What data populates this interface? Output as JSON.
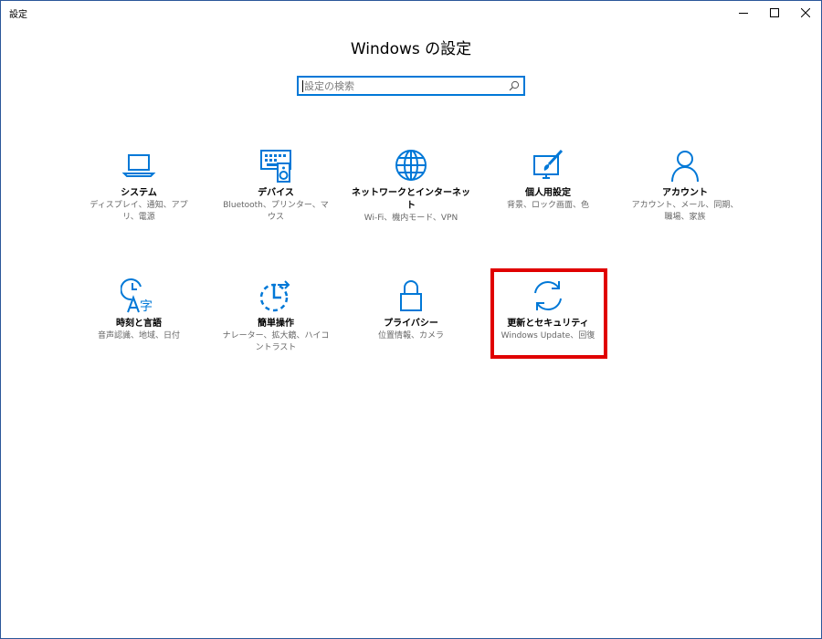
{
  "window": {
    "title": "設定",
    "controls": {
      "minimize": "minimize-icon",
      "maximize": "maximize-icon",
      "close": "close-icon"
    }
  },
  "heading": "Windows の設定",
  "search": {
    "placeholder": "設定の検索",
    "value": "",
    "icon": "search-icon"
  },
  "accent_color": "#0078d7",
  "highlight_color": "#e00000",
  "tiles": [
    {
      "id": "system",
      "icon": "laptop-icon",
      "label": "システム",
      "description": "ディスプレイ、通知、アプリ、電源"
    },
    {
      "id": "devices",
      "icon": "keyboard-speaker-icon",
      "label": "デバイス",
      "description": "Bluetooth、プリンター、マウス"
    },
    {
      "id": "network",
      "icon": "globe-icon",
      "label": "ネットワークとインターネット",
      "description": "Wi-Fi、機内モード、VPN"
    },
    {
      "id": "personalization",
      "icon": "paint-brush-icon",
      "label": "個人用設定",
      "description": "背景、ロック画面、色"
    },
    {
      "id": "accounts",
      "icon": "person-icon",
      "label": "アカウント",
      "description": "アカウント、メール、同期、職場、家族"
    },
    {
      "id": "time-language",
      "icon": "time-language-icon",
      "label": "時刻と言語",
      "description": "音声認識、地域、日付"
    },
    {
      "id": "ease-of-access",
      "icon": "ease-of-access-icon",
      "label": "簡単操作",
      "description": "ナレーター、拡大鏡、ハイコントラスト"
    },
    {
      "id": "privacy",
      "icon": "lock-icon",
      "label": "プライバシー",
      "description": "位置情報、カメラ"
    },
    {
      "id": "update-security",
      "icon": "refresh-icon",
      "label": "更新とセキュリティ",
      "description": "Windows Update、回復"
    }
  ]
}
